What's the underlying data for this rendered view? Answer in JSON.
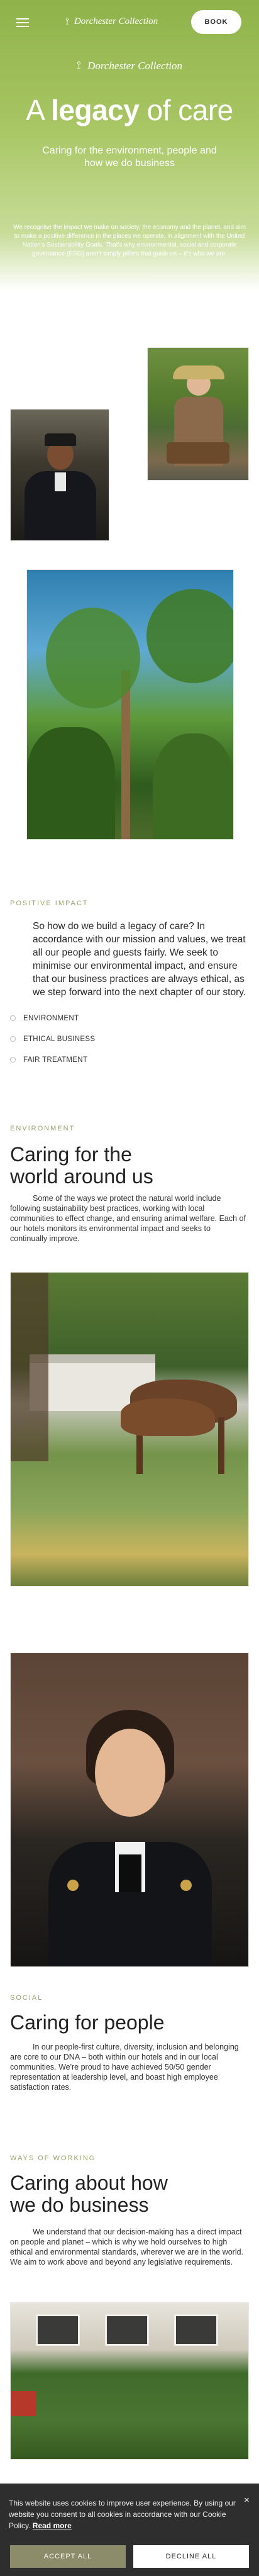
{
  "header": {
    "brand": "Dorchester Collection",
    "brand_mark": "⟟",
    "book_label": "BOOK"
  },
  "hero": {
    "title_prefix": "A",
    "title_bold": "legacy",
    "title_suffix": "of care",
    "subtitle": "Caring for the environment, people and how we do business",
    "body": "We recognise the impact we make on society, the economy and the planet, and aim to make a positive difference in the places we operate, in alignment with the United Nation's Sustainability Goals. That's why environmental, social and corporate governance (ESG) aren't simply pillars that guide us – it's who we are."
  },
  "intro": {
    "eyebrow": "POSITIVE IMPACT",
    "lead": "So how do we build a legacy of care? In accordance with our mission and values, we treat all our people and guests fairly. We seek to minimise our environmental impact, and ensure that our business practices are always ethical, as we step forward into the next chapter of our story.",
    "tabs": [
      {
        "label": "ENVIRONMENT"
      },
      {
        "label": "ETHICAL BUSINESS"
      },
      {
        "label": "FAIR TREATMENT"
      }
    ]
  },
  "environment": {
    "eyebrow": "ENVIRONMENT",
    "title": "Caring for the world around us",
    "body": "Some of the ways we protect the natural world include following sustainability best practices, working with local communities to effect change, and ensuring animal welfare. Each of our hotels monitors its environmental impact and seeks to continually improve."
  },
  "social": {
    "eyebrow": "SOCIAL",
    "title": "Caring for people",
    "body": "In our people-first culture, diversity, inclusion and belonging are core to our DNA – both within our hotels and in our local communities. We're proud to have achieved 50/50 gender representation at leadership level, and boast high employee satisfaction rates."
  },
  "working": {
    "eyebrow": "WAYS OF WORKING",
    "title": "Caring about how we do business",
    "body": "We understand that our decision-making has a direct impact on people and planet – which is why we hold ourselves to high ethical and environmental standards, wherever we are in the world. We aim to work above and beyond any legislative requirements."
  },
  "cookie": {
    "text": "This website uses cookies to improve user experience. By using our website you consent to all cookies in accordance with our Cookie Policy.",
    "link": "Read more",
    "close": "×",
    "accept": "ACCEPT ALL",
    "decline": "DECLINE ALL"
  },
  "colors": {
    "hero_green": "#9dbd5a",
    "eyebrow": "#9aa26a",
    "cookie_bg": "#2e2e2e",
    "accept_bg": "#8c8c6a"
  }
}
